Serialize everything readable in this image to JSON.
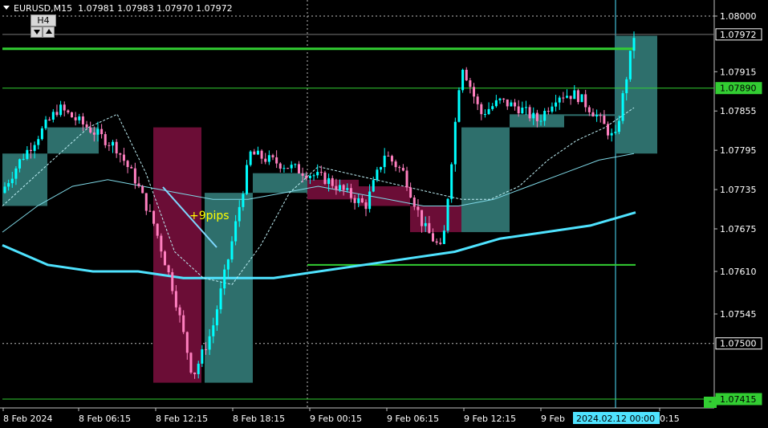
{
  "header": {
    "symbol": "EURUSD,M15",
    "ohlc": "1.07981 1.07983 1.07970 1.07972"
  },
  "timeframe_box": {
    "label": "H4"
  },
  "annotation": {
    "text": "+9pips"
  },
  "minimize_button": {
    "label": "-"
  },
  "colors": {
    "background": "#000000",
    "bull_candle": "#00ffff",
    "bear_candle": "#ff7fbf",
    "h4_bull_box": "#2e6f6c",
    "h4_bear_box": "#6b0d36",
    "level_line": "#32cd32",
    "ma_line": "#4fe3ff"
  },
  "price_axis": {
    "ticks": [
      "1.08000",
      "1.07915",
      "1.07855",
      "1.07795",
      "1.07735",
      "1.07675",
      "1.07610",
      "1.07545"
    ],
    "tagged_levels": [
      {
        "value": "1.07972",
        "style": "current"
      },
      {
        "value": "1.07890",
        "style": "green"
      },
      {
        "value": "1.07500",
        "style": "grid"
      },
      {
        "value": "1.07415",
        "style": "green"
      }
    ],
    "tick_values": [
      1.08,
      1.07915,
      1.07855,
      1.07795,
      1.07735,
      1.07675,
      1.0761,
      1.07545
    ]
  },
  "time_axis": {
    "labels": [
      "8 Feb 2024",
      "8 Feb 06:15",
      "8 Feb 12:15",
      "8 Feb 18:15",
      "9 Feb 00:15",
      "9 Feb 06:15",
      "9 Feb 12:15",
      "9 Feb",
      "0:15"
    ],
    "crosshair_label": "2024.02.12 00:00"
  },
  "chart_data": {
    "type": "candlestick",
    "symbol": "EURUSD",
    "timeframe": "M15",
    "ylim": [
      1.07405,
      1.08015
    ],
    "horizontal_levels": [
      1.0795,
      1.0789,
      1.0762
    ],
    "h4_boxes": [
      {
        "open": 1.0771,
        "close": 1.0779,
        "dir": "bull"
      },
      {
        "open": 1.0779,
        "close": 1.0783,
        "dir": "bull"
      },
      {
        "open": 1.0783,
        "close": 1.0744,
        "dir": "bear"
      },
      {
        "open": 1.0744,
        "close": 1.0773,
        "dir": "bull"
      },
      {
        "open": 1.0773,
        "close": 1.0776,
        "dir": "bull"
      },
      {
        "open": 1.0775,
        "close": 1.0772,
        "dir": "bear"
      },
      {
        "open": 1.0774,
        "close": 1.0771,
        "dir": "bear"
      },
      {
        "open": 1.0771,
        "close": 1.0767,
        "dir": "bear"
      },
      {
        "open": 1.0767,
        "close": 1.0783,
        "dir": "bull"
      },
      {
        "open": 1.0783,
        "close": 1.0785,
        "dir": "bull"
      },
      {
        "open": 1.0785,
        "close": 1.0785,
        "dir": "bull"
      },
      {
        "open": 1.0779,
        "close": 1.0797,
        "dir": "bull"
      }
    ],
    "price_path": [
      1.0773,
      1.0778,
      1.0782,
      1.0786,
      1.0784,
      1.0782,
      1.078,
      1.0775,
      1.0768,
      1.0758,
      1.0745,
      1.0752,
      1.0765,
      1.0779,
      1.0778,
      1.0777,
      1.0776,
      1.0775,
      1.0773,
      1.0771,
      1.0779,
      1.0776,
      1.0768,
      1.0764,
      1.0793,
      1.0785,
      1.0787,
      1.0786,
      1.0784,
      1.0788,
      1.0788,
      1.0785,
      1.0781,
      1.0797
    ],
    "ma_fast": [
      1.0771,
      1.0775,
      1.0779,
      1.0783,
      1.0785,
      1.0776,
      1.0764,
      1.076,
      1.0759,
      1.0765,
      1.0773,
      1.0777,
      1.0776,
      1.0775,
      1.0774,
      1.0773,
      1.0772,
      1.0772,
      1.0774,
      1.0778,
      1.0781,
      1.0783,
      1.0786
    ],
    "ma_mid": [
      1.0767,
      1.0771,
      1.0774,
      1.0775,
      1.0774,
      1.0773,
      1.0772,
      1.0772,
      1.0773,
      1.0774,
      1.0773,
      1.0772,
      1.0771,
      1.0771,
      1.0772,
      1.0774,
      1.0776,
      1.0778,
      1.0779
    ],
    "ma_slow": [
      1.0765,
      1.0762,
      1.0761,
      1.0761,
      1.076,
      1.076,
      1.076,
      1.0761,
      1.0762,
      1.0763,
      1.0764,
      1.0766,
      1.0767,
      1.0768,
      1.077
    ]
  }
}
